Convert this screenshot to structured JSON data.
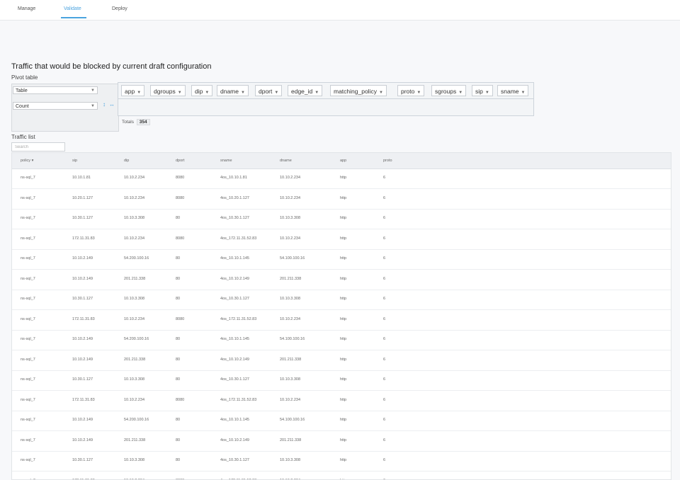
{
  "tabs": [
    "Manage",
    "Validate",
    "Deploy"
  ],
  "heading": "Traffic that would be blocked by current draft configuration",
  "pivot": {
    "label": "Pivot table",
    "renderer": "Table",
    "aggregator": "Count",
    "fields": [
      "app",
      "dgroups",
      "dip",
      "dname",
      "dport",
      "edge_id",
      "matching_policy",
      "proto",
      "sgroups",
      "sip",
      "sname"
    ],
    "totals_label": "Totals",
    "totals_value": "354"
  },
  "traffic": {
    "label": "Traffic list",
    "search_placeholder": "Search",
    "columns": [
      "policy",
      "sip",
      "dip",
      "dport",
      "sname",
      "dname",
      "app",
      "proto"
    ],
    "rows": [
      [
        "ns-sql_7",
        "10.10.1.81",
        "10.10.2.234",
        "8080",
        "4os_10.10.1.81",
        "10.10.2.234",
        "http",
        "6"
      ],
      [
        "ns-sql_7",
        "10.20.1.127",
        "10.10.2.234",
        "8080",
        "4os_10.20.1.127",
        "10.10.2.234",
        "http",
        "6"
      ],
      [
        "ns-sql_7",
        "10.30.1.127",
        "10.10.3.308",
        "80",
        "4os_10.30.1.127",
        "10.10.3.308",
        "http",
        "6"
      ],
      [
        "ns-sql_7",
        "172.11.31.83",
        "10.10.2.234",
        "8080",
        "4os_172.11.31.52.83",
        "10.10.2.234",
        "http",
        "6"
      ],
      [
        "ns-sql_7",
        "10.10.2.149",
        "54.200.100.16",
        "80",
        "4os_10.10.1.145",
        "54.100.100.16",
        "http",
        "6"
      ],
      [
        "ns-sql_7",
        "10.10.2.149",
        "201.211.338",
        "80",
        "4os_10.10.2.149",
        "201.211.338",
        "http",
        "6"
      ],
      [
        "ns-sql_7",
        "10.30.1.127",
        "10.10.3.308",
        "80",
        "4os_10.30.1.127",
        "10.10.3.308",
        "http",
        "6"
      ],
      [
        "ns-sql_7",
        "172.11.31.83",
        "10.10.2.234",
        "8080",
        "4os_172.11.31.52.83",
        "10.10.2.234",
        "http",
        "6"
      ],
      [
        "ns-sql_7",
        "10.10.2.149",
        "54.200.100.16",
        "80",
        "4os_10.10.1.145",
        "54.100.100.16",
        "http",
        "6"
      ],
      [
        "ns-sql_7",
        "10.10.2.149",
        "201.211.338",
        "80",
        "4os_10.10.2.149",
        "201.211.338",
        "http",
        "6"
      ],
      [
        "ns-sql_7",
        "10.30.1.127",
        "10.10.3.308",
        "80",
        "4os_10.30.1.127",
        "10.10.3.308",
        "http",
        "6"
      ],
      [
        "ns-sql_7",
        "172.11.31.83",
        "10.10.2.234",
        "8080",
        "4os_172.11.31.52.83",
        "10.10.2.234",
        "http",
        "6"
      ],
      [
        "ns-sql_7",
        "10.10.2.149",
        "54.200.100.16",
        "80",
        "4os_10.10.1.145",
        "54.100.100.16",
        "http",
        "6"
      ],
      [
        "ns-sql_7",
        "10.10.2.149",
        "201.211.338",
        "80",
        "4os_10.10.2.149",
        "201.211.338",
        "http",
        "6"
      ],
      [
        "ns-sql_7",
        "10.30.1.127",
        "10.10.3.308",
        "80",
        "4os_10.30.1.127",
        "10.10.3.308",
        "http",
        "6"
      ],
      [
        "ns-sql_7",
        "172.11.31.83",
        "10.10.2.234",
        "8080",
        "4os_172.11.31.52.83",
        "10.10.2.234",
        "http",
        "6"
      ]
    ]
  },
  "colors": {
    "accent": "#4aa3df",
    "header_bg": "#eef0f3"
  }
}
